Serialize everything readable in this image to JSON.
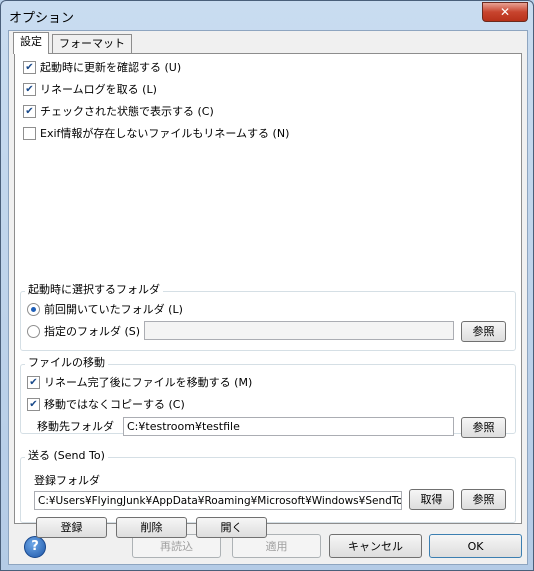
{
  "window": {
    "title": "オプション",
    "close_glyph": "✕"
  },
  "tabs": [
    {
      "label": "設定"
    },
    {
      "label": "フォーマット"
    }
  ],
  "options": [
    {
      "label": "起動時に更新を確認する (U)",
      "checked": true
    },
    {
      "label": "リネームログを取る (L)",
      "checked": true
    },
    {
      "label": "チェックされた状態で表示する (C)",
      "checked": true
    },
    {
      "label": "Exif情報が存在しないファイルもリネームする (N)",
      "checked": false
    }
  ],
  "startup_folder": {
    "title": "起動時に選択するフォルダ",
    "radio_previous": "前回開いていたフォルダ (L)",
    "radio_specified": "指定のフォルダ (S)",
    "selected": "previous",
    "path_value": "",
    "browse_label": "参照"
  },
  "file_move": {
    "title": "ファイルの移動",
    "move_after_rename": {
      "label": "リネーム完了後にファイルを移動する (M)",
      "checked": true
    },
    "copy_instead": {
      "label": "移動ではなくコピーする (C)",
      "checked": true
    },
    "dest_label": "移動先フォルダ",
    "dest_value": "C:¥testroom¥testfile",
    "browse_label": "参照"
  },
  "send_to": {
    "title": "送る (Send To)",
    "folder_label": "登録フォルダ",
    "folder_value": "C:¥Users¥FlyingJunk¥AppData¥Roaming¥Microsoft¥Windows¥SendTo",
    "get_label": "取得",
    "browse_label": "参照",
    "register_label": "登録",
    "delete_label": "削除",
    "open_label": "開く"
  },
  "footer": {
    "help_glyph": "?",
    "reload_label": "再読込",
    "apply_label": "適用",
    "cancel_label": "キャンセル",
    "ok_label": "OK"
  }
}
